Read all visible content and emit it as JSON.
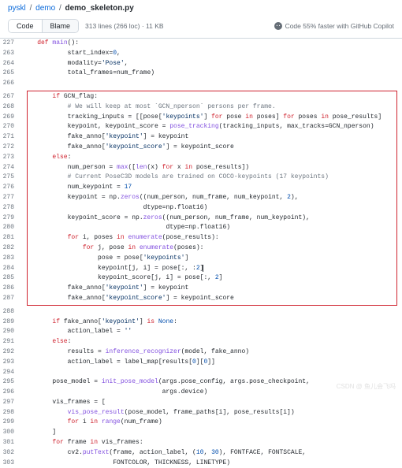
{
  "breadcrumb": {
    "root": "pyskl",
    "mid": "demo",
    "file": "demo_skeleton.py"
  },
  "toolbar": {
    "code_tab": "Code",
    "blame_tab": "Blame",
    "meta": "313 lines (266 loc) · 11 KB",
    "copilot": "Code 55% faster with GitHub Copilot"
  },
  "lines": {
    "227": {
      "t": "def main():"
    },
    "263": {
      "t": "            start_index=0,"
    },
    "264": {
      "t": "            modality='Pose',"
    },
    "265": {
      "t": "            total_frames=num_frame)"
    },
    "266": {
      "t": ""
    },
    "267": {
      "t": "        if GCN_flag:"
    },
    "268": {
      "t": "            # We will keep at most `GCN_nperson` persons per frame."
    },
    "269": {
      "t": "            tracking_inputs = [[pose['keypoints'] for pose in poses] for poses in pose_results]"
    },
    "270": {
      "t": "            keypoint, keypoint_score = pose_tracking(tracking_inputs, max_tracks=GCN_nperson)"
    },
    "271": {
      "t": "            fake_anno['keypoint'] = keypoint"
    },
    "272": {
      "t": "            fake_anno['keypoint_score'] = keypoint_score"
    },
    "273": {
      "t": "        else:"
    },
    "274": {
      "t": "            num_person = max([len(x) for x in pose_results])"
    },
    "275": {
      "t": "            # Current PoseC3D models are trained on COCO-keypoints (17 keypoints)"
    },
    "276": {
      "t": "            num_keypoint = 17"
    },
    "277": {
      "t": "            keypoint = np.zeros((num_person, num_frame, num_keypoint, 2),"
    },
    "278": {
      "t": "                                dtype=np.float16)"
    },
    "279": {
      "t": "            keypoint_score = np.zeros((num_person, num_frame, num_keypoint),"
    },
    "280": {
      "t": "                                      dtype=np.float16)"
    },
    "281": {
      "t": "            for i, poses in enumerate(pose_results):"
    },
    "282": {
      "t": "                for j, pose in enumerate(poses):"
    },
    "283": {
      "t": "                    pose = pose['keypoints']"
    },
    "284": {
      "t": "                    keypoint[j, i] = pose[:, :2]"
    },
    "285": {
      "t": "                    keypoint_score[j, i] = pose[:, 2]"
    },
    "286": {
      "t": "            fake_anno['keypoint'] = keypoint"
    },
    "287": {
      "t": "            fake_anno['keypoint_score'] = keypoint_score"
    },
    "288": {
      "t": ""
    },
    "289": {
      "t": "        if fake_anno['keypoint'] is None:"
    },
    "290": {
      "t": "            action_label = ''"
    },
    "291": {
      "t": "        else:"
    },
    "292": {
      "t": "            results = inference_recognizer(model, fake_anno)"
    },
    "293": {
      "t": "            action_label = label_map[results[0][0]]"
    },
    "294": {
      "t": ""
    },
    "295": {
      "t": "        pose_model = init_pose_model(args.pose_config, args.pose_checkpoint,"
    },
    "296": {
      "t": "                                     args.device)"
    },
    "297": {
      "t": "        vis_frames = ["
    },
    "298": {
      "t": "            vis_pose_result(pose_model, frame_paths[i], pose_results[i])"
    },
    "299": {
      "t": "            for i in range(num_frame)"
    },
    "300": {
      "t": "        ]"
    },
    "301": {
      "t": "        for frame in vis_frames:"
    },
    "302": {
      "t": "            cv2.putText(frame, action_label, (10, 30), FONTFACE, FONTSCALE,"
    },
    "303": {
      "t": "                        FONTCOLOR, THICKNESS, LINETYPE)"
    }
  },
  "watermark": "CSDN @ 鱼儿会飞吗"
}
